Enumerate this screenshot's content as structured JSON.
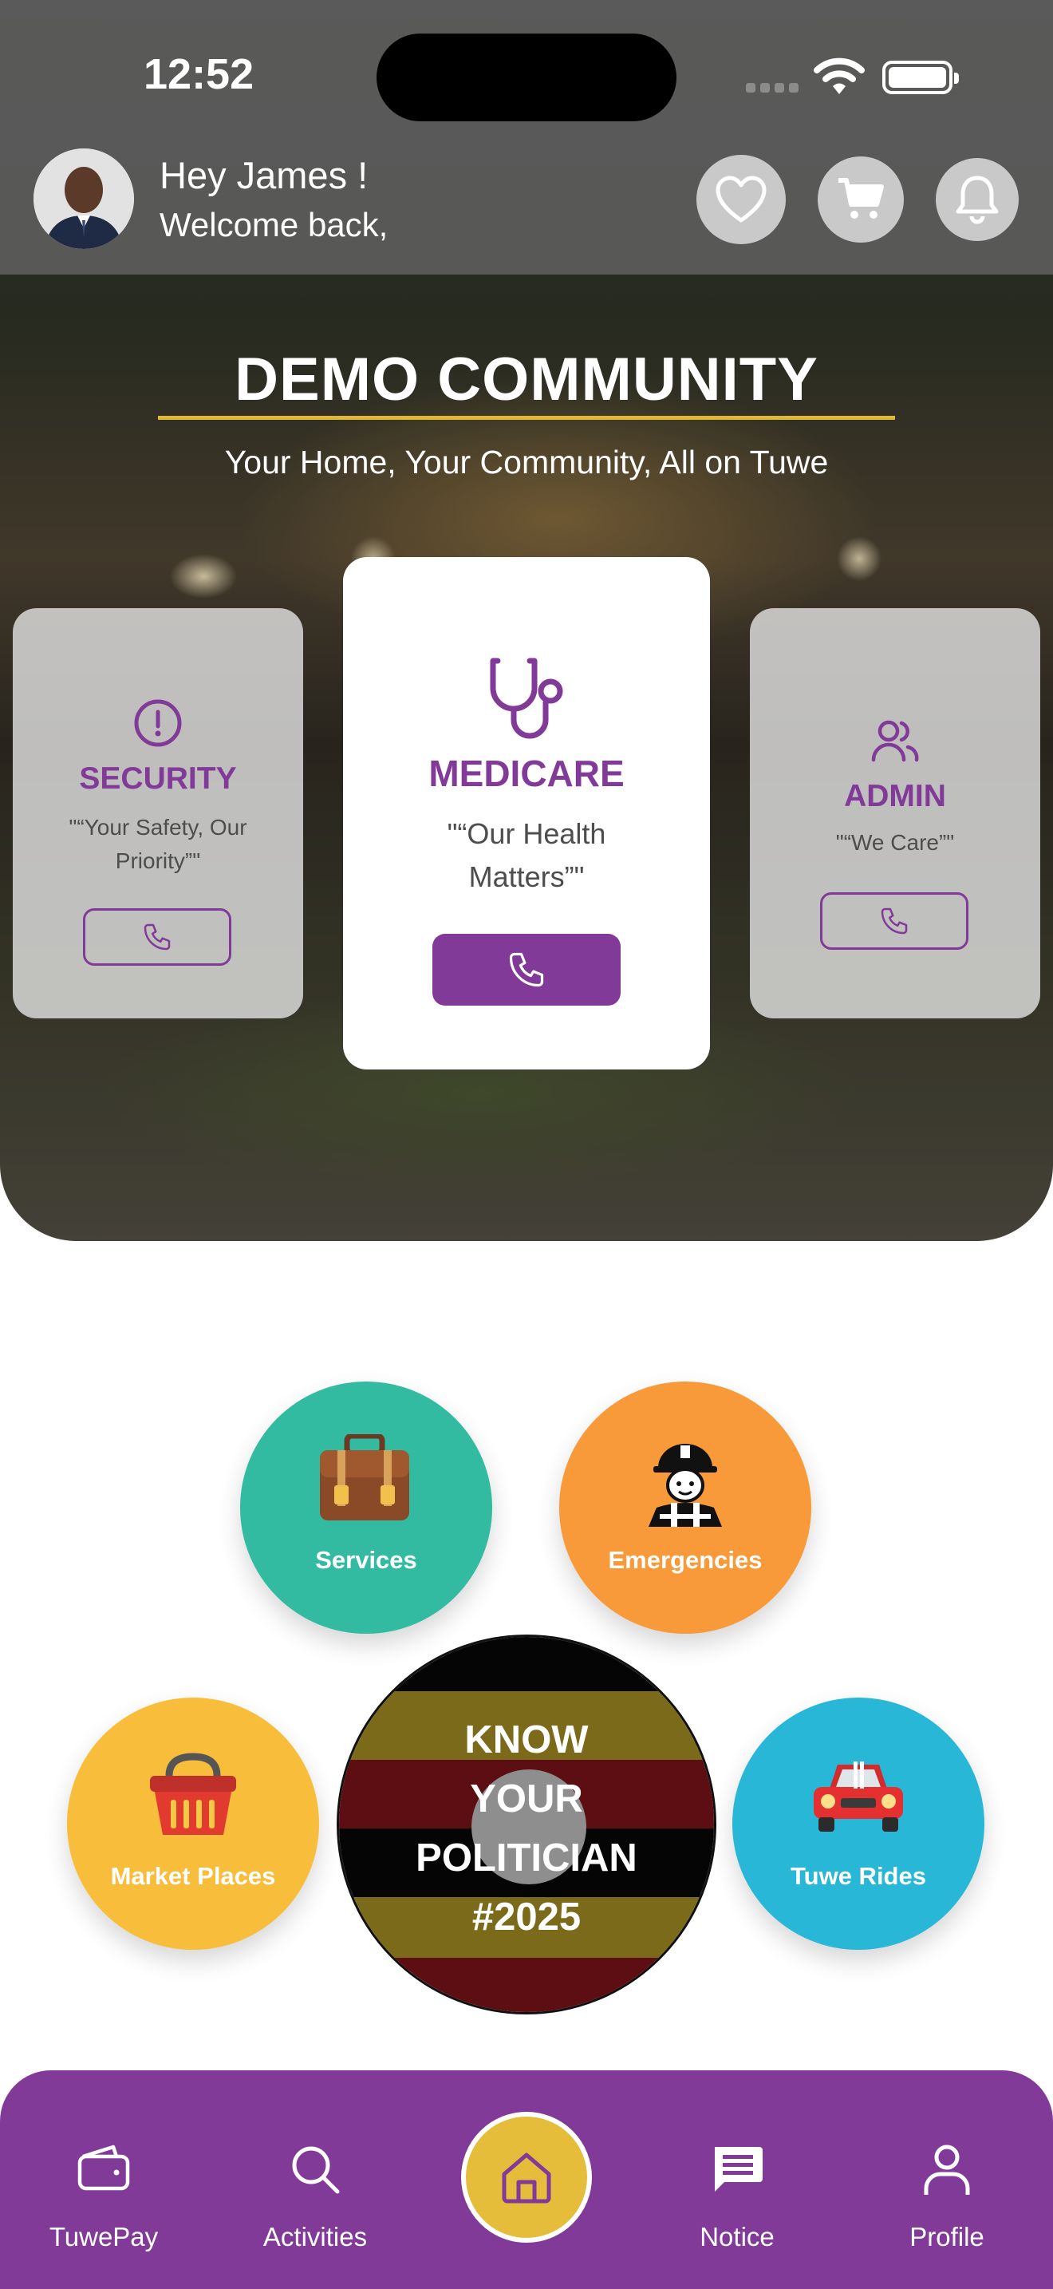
{
  "status_bar": {
    "time": "12:52"
  },
  "header": {
    "greeting": "Hey James !",
    "welcome": "Welcome back,",
    "icons": [
      "heart-icon",
      "cart-icon",
      "bell-icon"
    ]
  },
  "hero": {
    "title": "DEMO COMMUNITY",
    "subtitle": "Your Home, Your Community, All on Tuwe",
    "accent_color": "#823a99",
    "underline_color": "#e2b734",
    "cards": [
      {
        "name": "SECURITY",
        "quote": "\"“Your Safety, Our Priority”\"",
        "icon": "alert-circle-icon"
      },
      {
        "name": "MEDICARE",
        "quote": "\"“Our Health Matters”\"",
        "icon": "stethoscope-icon"
      },
      {
        "name": "ADMIN",
        "quote": "\"“We Care”\"",
        "icon": "users-icon"
      }
    ]
  },
  "services": {
    "items": [
      {
        "label": "Services",
        "color": "#33bba1",
        "icon": "briefcase-icon"
      },
      {
        "label": "Emergencies",
        "color": "#f8993a",
        "icon": "firefighter-icon"
      },
      {
        "label": "Market Places",
        "color": "#f8bd3a",
        "icon": "basket-icon"
      },
      {
        "label": "Tuwe Rides",
        "color": "#28b7d6",
        "icon": "car-icon"
      }
    ],
    "politician": {
      "line1": "KNOW",
      "line2": "YOUR",
      "line3": "POLITICIAN",
      "line4": "#2025"
    }
  },
  "bottom_nav": {
    "items": [
      {
        "label": "TuwePay",
        "icon": "wallet-icon"
      },
      {
        "label": "Activities",
        "icon": "search-icon"
      },
      {
        "label": "Notice",
        "icon": "message-icon"
      },
      {
        "label": "Profile",
        "icon": "user-icon"
      }
    ],
    "home_icon": "home-icon",
    "background": "#823a99",
    "home_color": "#e6bd3a"
  }
}
